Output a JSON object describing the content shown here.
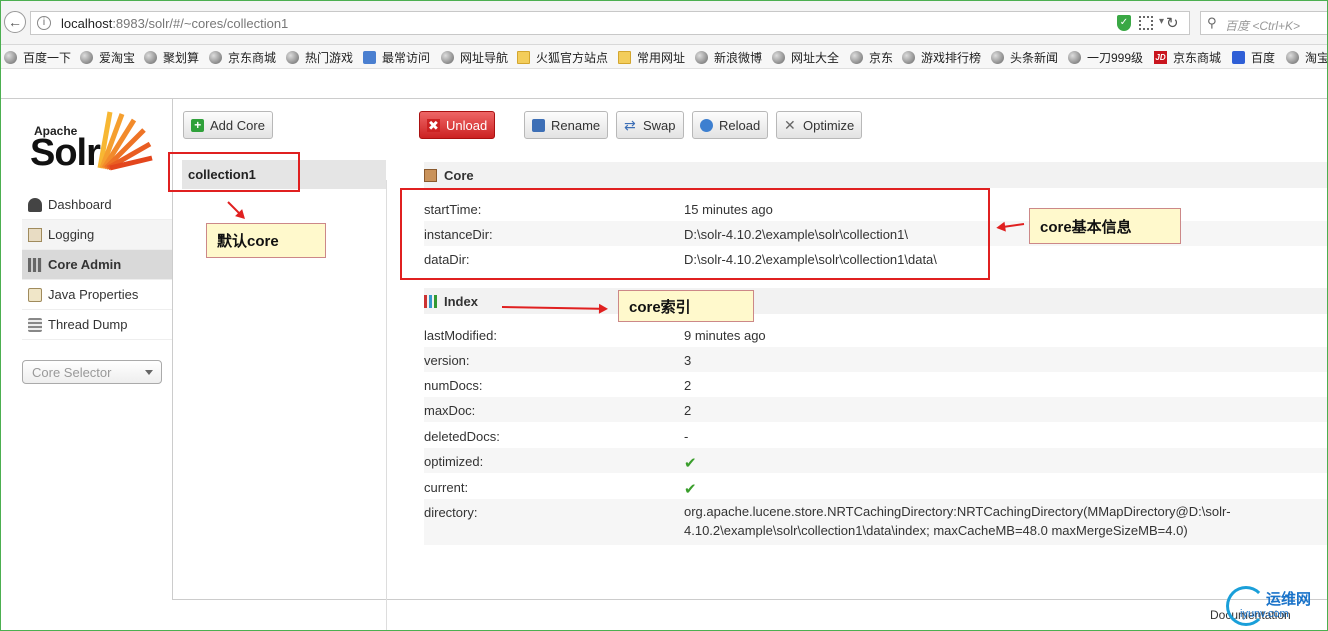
{
  "browser": {
    "url_host": "localhost",
    "url_rest": ":8983/solr/#/~cores/collection1",
    "search_placeholder": "百度 <Ctrl+K>",
    "bookmarks": [
      "百度一下",
      "爱淘宝",
      "聚划算",
      "京东商城",
      "热门游戏",
      "最常访问",
      "网址导航",
      "火狐官方站点",
      "常用网址",
      "新浪微博",
      "网址大全",
      "京东",
      "游戏排行榜",
      "头条新闻",
      "一刀999级",
      "京东商城",
      "百度",
      "淘宝"
    ]
  },
  "logo": {
    "apache": "Apache",
    "solr": "Solr"
  },
  "nav": {
    "items": [
      {
        "label": "Dashboard"
      },
      {
        "label": "Logging"
      },
      {
        "label": "Core Admin"
      },
      {
        "label": "Java Properties"
      },
      {
        "label": "Thread Dump"
      }
    ],
    "core_selector": "Core Selector"
  },
  "toolbar": {
    "add_core": "Add Core",
    "unload": "Unload",
    "rename": "Rename",
    "swap": "Swap",
    "reload": "Reload",
    "optimize": "Optimize"
  },
  "core_list": [
    "collection1"
  ],
  "core_section": {
    "title": "Core",
    "rows": [
      {
        "key": "startTime:",
        "value": "15 minutes ago"
      },
      {
        "key": "instanceDir:",
        "value": "D:\\solr-4.10.2\\example\\solr\\collection1\\"
      },
      {
        "key": "dataDir:",
        "value": "D:\\solr-4.10.2\\example\\solr\\collection1\\data\\"
      }
    ]
  },
  "index_section": {
    "title": "Index",
    "rows": [
      {
        "key": "lastModified:",
        "value": "9 minutes ago"
      },
      {
        "key": "version:",
        "value": "3"
      },
      {
        "key": "numDocs:",
        "value": "2"
      },
      {
        "key": "maxDoc:",
        "value": "2"
      },
      {
        "key": "deletedDocs:",
        "value": "-"
      },
      {
        "key": "optimized:",
        "value": "✔"
      },
      {
        "key": "current:",
        "value": "✔"
      },
      {
        "key": "directory:",
        "value": "org.apache.lucene.store.NRTCachingDirectory:NRTCachingDirectory(MMapDirectory@D:\\solr-4.10.2\\example\\solr\\collection1\\data\\index; maxCacheMB=48.0 maxMergeSizeMB=4.0)"
      }
    ]
  },
  "annotations": {
    "default_core": "默认core",
    "core_info": "core基本信息",
    "core_index": "core索引"
  },
  "footer": {
    "documentation": "Documentation"
  },
  "watermark": {
    "top": "运维网",
    "bottom": "iyunv.com"
  }
}
